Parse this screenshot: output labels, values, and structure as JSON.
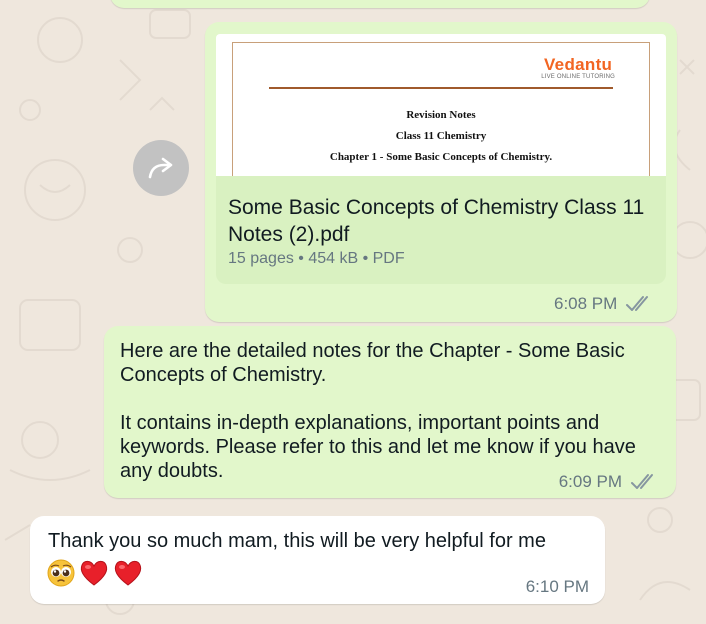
{
  "colors": {
    "wallpaper": "#efe7dd",
    "outgoing_bubble": "#e2f7cb",
    "incoming_bubble": "#ffffff",
    "file_footer": "#d9f1c1",
    "read_ticks": "#8696a0"
  },
  "icons": {
    "forward": "forward-arrow-icon",
    "ticks": "double-check-icon",
    "emojis": [
      "pleading-face",
      "red-heart",
      "red-heart"
    ]
  },
  "document_message": {
    "preview": {
      "logo_text": "Vedantu",
      "logo_subtext": "LIVE ONLINE TUTORING",
      "line1": "Revision Notes",
      "line2": "Class 11 Chemistry",
      "line3": "Chapter 1 - Some Basic Concepts of Chemistry."
    },
    "file_name": "Some Basic Concepts of Chemistry Class 11 Notes (2).pdf",
    "file_meta": "15 pages • 454 kB • PDF",
    "time": "6:08 PM"
  },
  "text_message": {
    "text": "Here are the detailed notes for the Chapter - Some Basic Concepts of Chemistry.\n\nIt contains in-depth explanations, important points and keywords. Please refer to this and let me know if you have any doubts.",
    "time": "6:09 PM"
  },
  "reply_message": {
    "text": "Thank you so much mam, this will be very helpful for me",
    "time": "6:10 PM"
  }
}
